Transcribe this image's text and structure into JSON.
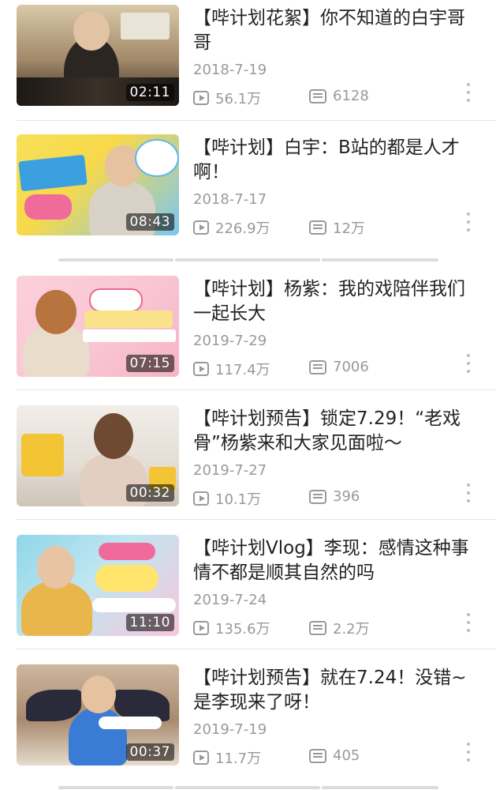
{
  "videos": [
    {
      "title": "【哔计划花絮】你不知道的白宇哥哥",
      "date": "2018-7-19",
      "views": "56.1万",
      "danmaku": "6128",
      "duration": "02:11",
      "thumb_colors": [
        "#5a4a3a",
        "#c9a878",
        "#f2e6d0"
      ]
    },
    {
      "title": "【哔计划】白宇：B站的都是人才啊！",
      "date": "2018-7-17",
      "views": "226.9万",
      "danmaku": "12万",
      "duration": "08:43",
      "thumb_colors": [
        "#f7d94a",
        "#4fb0e8",
        "#f06a9a"
      ]
    },
    {
      "title": "【哔计划】杨紫：我的戏陪伴我们一起长大",
      "date": "2019-7-29",
      "views": "117.4万",
      "danmaku": "7006",
      "duration": "07:15",
      "thumb_colors": [
        "#f9c4d2",
        "#f9e28a",
        "#e86a8a"
      ]
    },
    {
      "title": "【哔计划预告】锁定7.29！“老戏骨”杨紫来和大家见面啦～",
      "date": "2019-7-27",
      "views": "10.1万",
      "danmaku": "396",
      "duration": "00:32",
      "thumb_colors": [
        "#e8e3dc",
        "#f3c433",
        "#d7b9a3"
      ]
    },
    {
      "title": "【哔计划Vlog】李现：感情这种事情不都是顺其自然的吗",
      "date": "2019-7-24",
      "views": "135.6万",
      "danmaku": "2.2万",
      "duration": "11:10",
      "thumb_colors": [
        "#8fd6e8",
        "#f7a8c8",
        "#ffe56b"
      ]
    },
    {
      "title": "【哔计划预告】就在7.24！没错~是李现来了呀！",
      "date": "2019-7-19",
      "views": "11.7万",
      "danmaku": "405",
      "duration": "00:37",
      "thumb_colors": [
        "#b99578",
        "#2a2a3a",
        "#e8d9c6"
      ]
    }
  ]
}
